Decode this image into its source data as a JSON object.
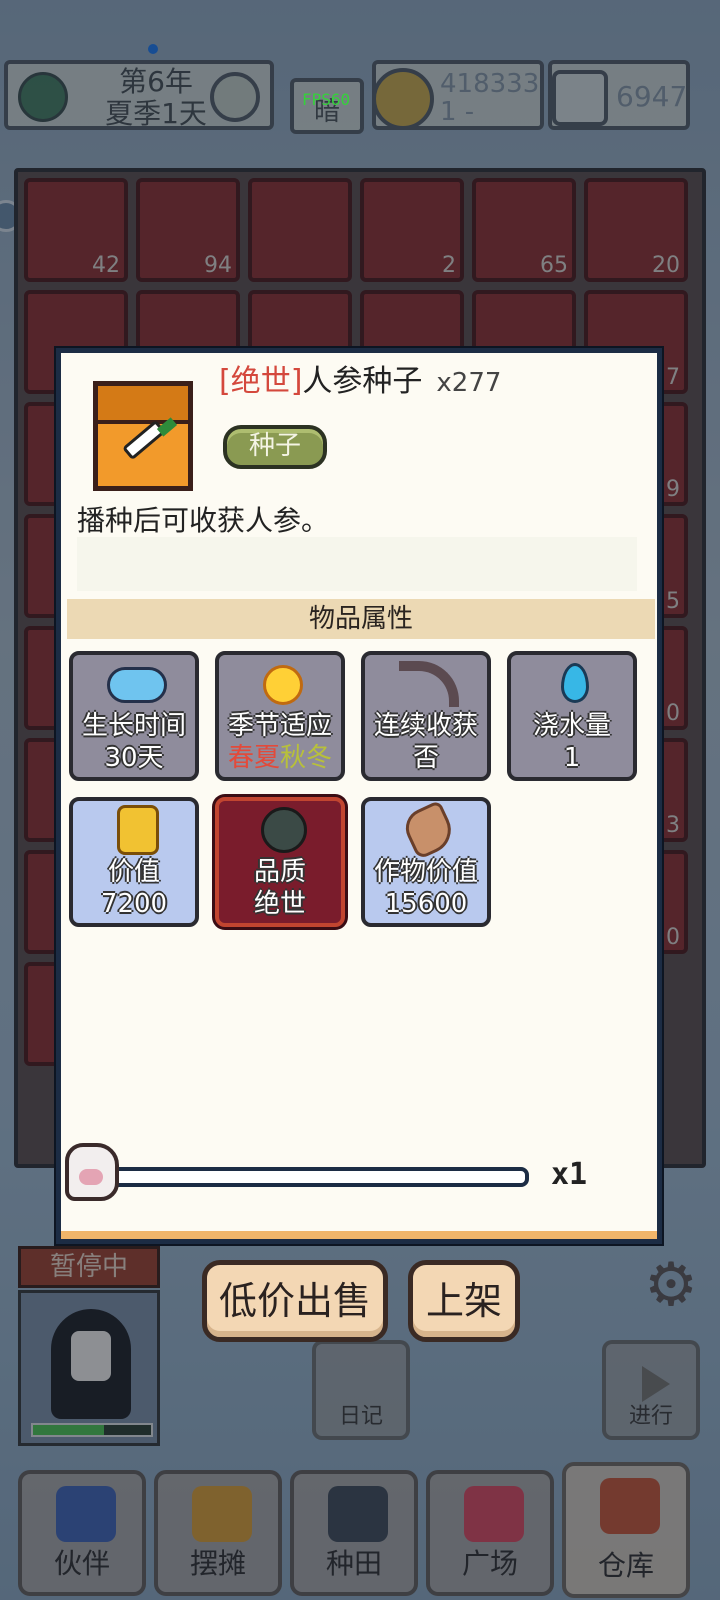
{
  "hud": {
    "year": "第6年",
    "season_day": "夏季1天",
    "dark_label": "暗",
    "fps": "FPS60",
    "coins_line1": "418333",
    "coins_line2": "1 -",
    "gems": "6947"
  },
  "inventory": {
    "counts": [
      "42",
      "94",
      "",
      "2",
      "65",
      "20"
    ],
    "side_counts": [
      "7",
      "9",
      "5",
      "0",
      "3",
      "0"
    ]
  },
  "status": {
    "paused": "暂停中"
  },
  "modal": {
    "quality_tag": "[绝世]",
    "item_name": "人参种子",
    "quantity": "x277",
    "type_tag": "种子",
    "description": "播种后可收获人参。",
    "attributes_header": "物品属性",
    "cards": {
      "grow_time": {
        "label": "生长时间",
        "value": "30天",
        "icon": "cloud-icon"
      },
      "season": {
        "label": "季节适应",
        "spring": "春",
        "summer": "夏",
        "autumn": "秋",
        "winter": "冬",
        "icon": "sun-icon"
      },
      "regrow": {
        "label": "连续收获",
        "value": "否",
        "icon": "sickle-icon"
      },
      "water": {
        "label": "浇水量",
        "value": "1",
        "icon": "water-drop-icon"
      },
      "price": {
        "label": "价值",
        "value": "7200",
        "icon": "coin-stack-icon"
      },
      "quality": {
        "label": "品质",
        "value": "绝世",
        "icon": "quality-gem-icon"
      },
      "crop_value": {
        "label": "作物价值",
        "value": "15600",
        "icon": "ginseng-icon"
      }
    },
    "multiplier": "x1",
    "colors": {
      "quality_red": "#d4483c",
      "spring_summer": "#e34a3a",
      "autumn_winter": "#b8c03a"
    }
  },
  "actions": {
    "sell_low": "低价出售",
    "list_on_shelf": "上架",
    "diary": "日记",
    "proceed": "进行"
  },
  "nav": [
    {
      "label": "伙伴",
      "icon": "partner-icon"
    },
    {
      "label": "摆摊",
      "icon": "stall-icon"
    },
    {
      "label": "种田",
      "icon": "farm-icon"
    },
    {
      "label": "广场",
      "icon": "plaza-icon"
    },
    {
      "label": "仓库",
      "icon": "warehouse-icon"
    }
  ]
}
